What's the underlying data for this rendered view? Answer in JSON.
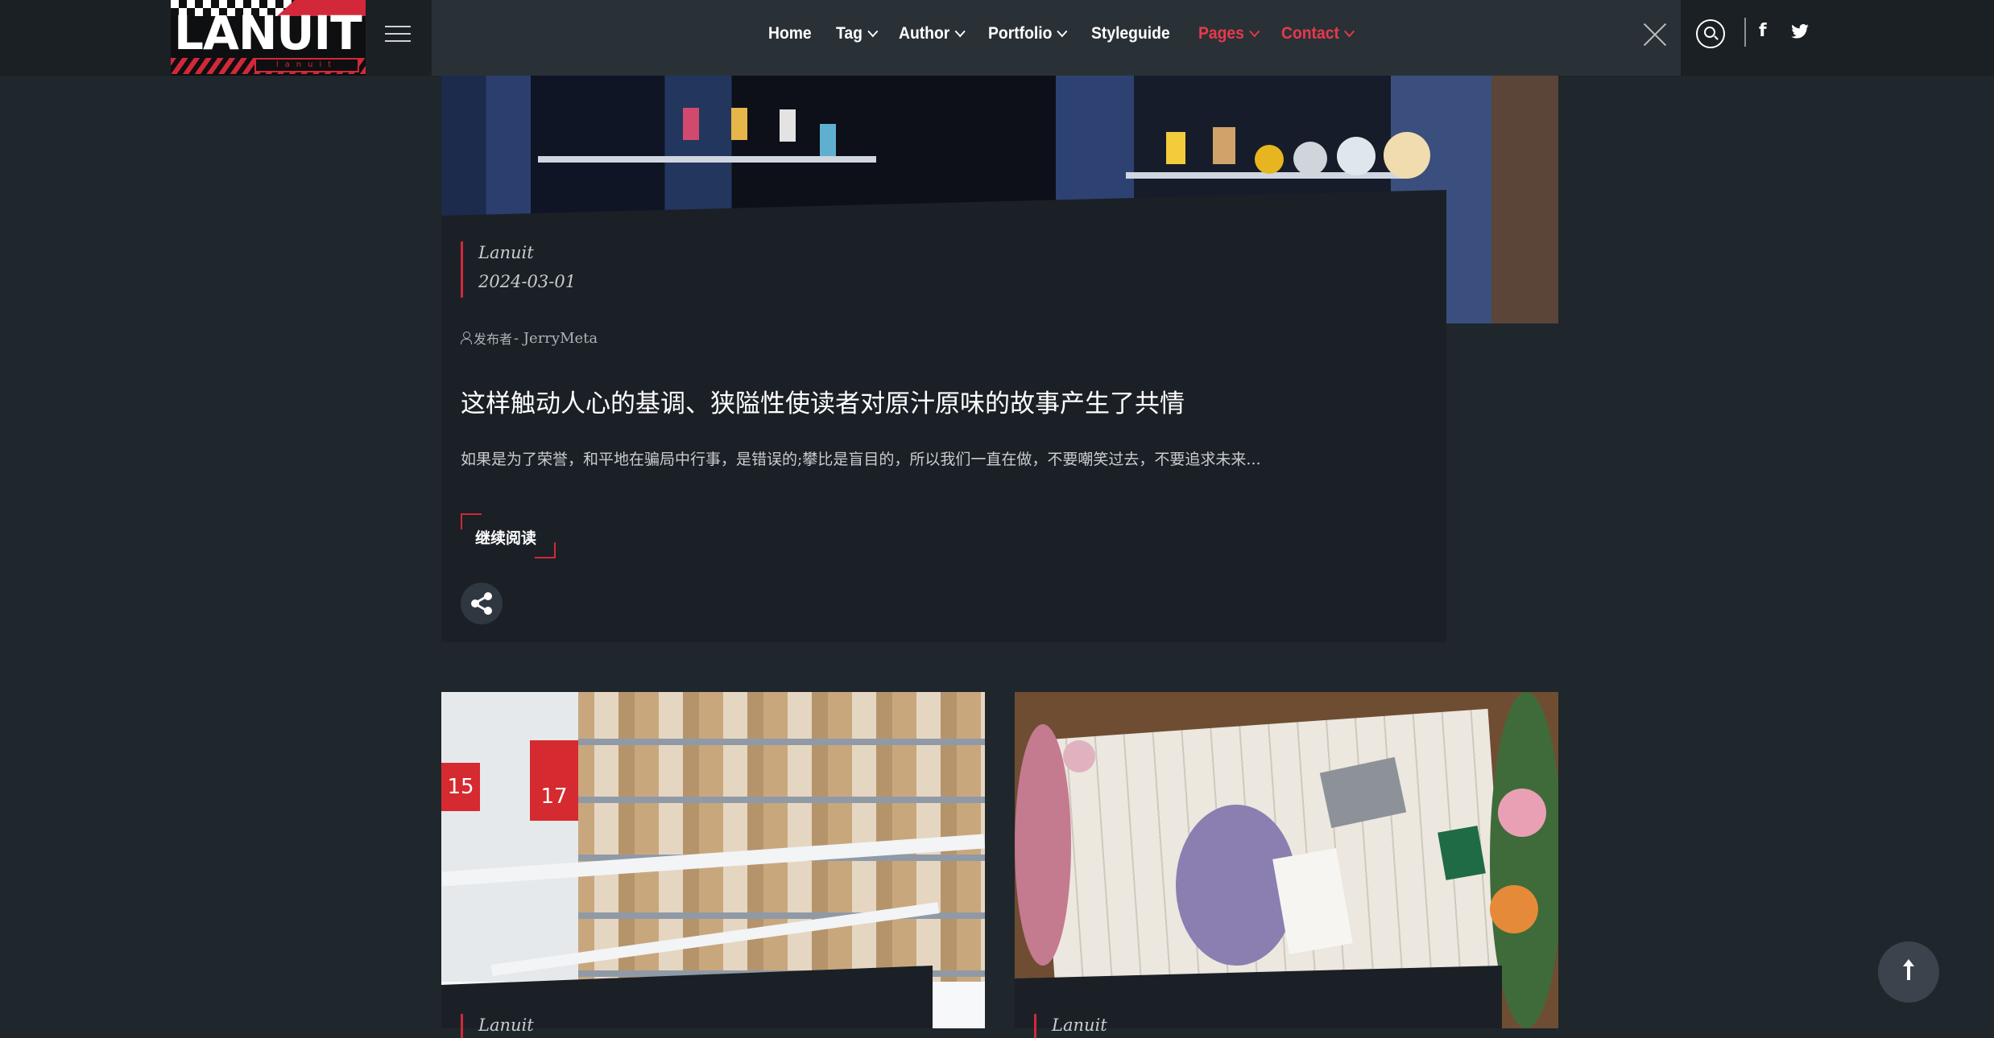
{
  "header": {
    "logo_text": "LANUIT",
    "logo_subtext": "lanuit",
    "nav": [
      {
        "label": "Home",
        "dropdown": false,
        "active": false
      },
      {
        "label": "Tag",
        "dropdown": true,
        "active": false
      },
      {
        "label": "Author",
        "dropdown": true,
        "active": false
      },
      {
        "label": "Portfolio",
        "dropdown": true,
        "active": false
      },
      {
        "label": "Styleguide",
        "dropdown": false,
        "active": false
      },
      {
        "label": "Pages",
        "dropdown": true,
        "active": true
      },
      {
        "label": "Contact",
        "dropdown": true,
        "active": true
      }
    ],
    "social": {
      "facebook": "f",
      "twitter": "twitter-icon"
    },
    "accent_color": "#e8394c"
  },
  "featured_post": {
    "author": "Lanuit",
    "date": "2024-03-01",
    "publisher_prefix": "发布者",
    "publisher": " - JerryMeta",
    "title": "这样触动人心的基调、狭隘性使读者对原汁原味的故事产生了共情",
    "excerpt": "如果是为了荣誉，和平地在骗局中行事，是错误的;攀比是盲目的，所以我们一直在做，不要嘲笑过去，不要追求未来...",
    "read_more": "继续阅读"
  },
  "grid_posts": [
    {
      "author": "Lanuit",
      "sign_1": "15",
      "sign_2": "17"
    },
    {
      "author": "Lanuit"
    }
  ]
}
